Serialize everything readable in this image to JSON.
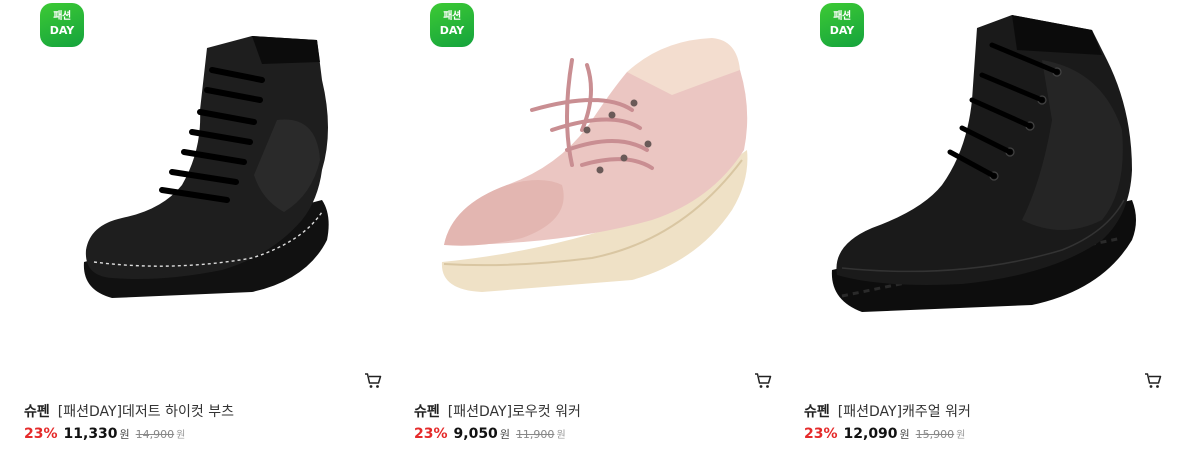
{
  "products": [
    {
      "badge_line1": "패션",
      "badge_line2": "DAY",
      "brand": "슈펜",
      "name": "[패션DAY]데저트 하이컷 부츠",
      "discount": "23%",
      "price": "11,330",
      "currency": "원",
      "original_price": "14,900",
      "original_currency": "원",
      "image": "black-high-top-lace-up-boot",
      "image_color": "#1c1c1c"
    },
    {
      "badge_line1": "패션",
      "badge_line2": "DAY",
      "brand": "슈펜",
      "name": "[패션DAY]로우컷 워커",
      "discount": "23%",
      "price": "9,050",
      "currency": "원",
      "original_price": "11,900",
      "original_currency": "원",
      "image": "pink-suede-low-cut-walker",
      "image_color": "#e8c4bf"
    },
    {
      "badge_line1": "패션",
      "badge_line2": "DAY",
      "brand": "슈펜",
      "name": "[패션DAY]캐주얼 워커",
      "discount": "23%",
      "price": "12,090",
      "currency": "원",
      "original_price": "15,900",
      "original_currency": "원",
      "image": "black-casual-walker-boot",
      "image_color": "#151515"
    }
  ],
  "colors": {
    "badge_green": "#1fb13a",
    "discount_red": "#e52a2a"
  },
  "icons": {
    "cart": "cart-icon"
  }
}
